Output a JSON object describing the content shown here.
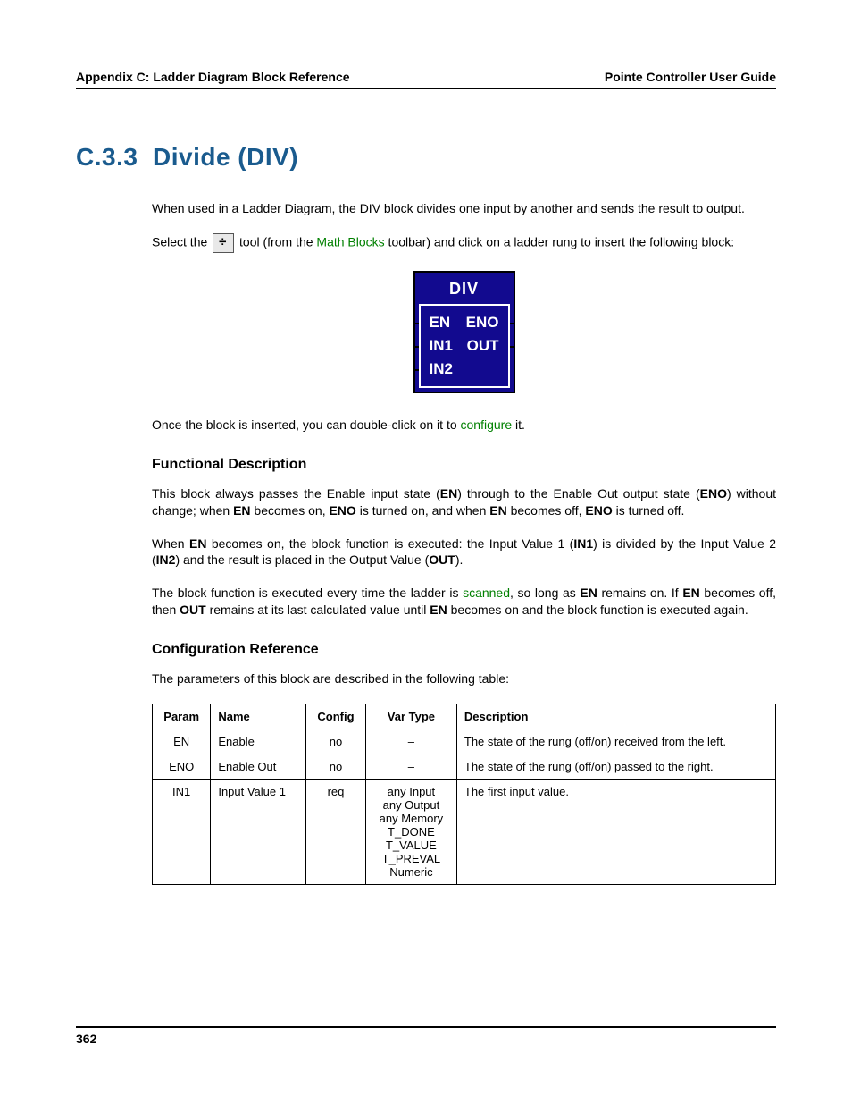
{
  "header": {
    "left": "Appendix C: Ladder Diagram Block Reference",
    "right": "Pointe Controller User Guide"
  },
  "section": {
    "number": "C.3.3",
    "title": "Divide (DIV)"
  },
  "intro": "When used in a Ladder Diagram, the DIV block divides one input by another and sends the result to output.",
  "select_pre": "Select the ",
  "select_mid": " tool (from the ",
  "select_link": "Math Blocks",
  "select_post": " toolbar) and click on a ladder rung to insert the following block:",
  "block": {
    "title": "DIV",
    "rows": {
      "r1l": "EN",
      "r1r": "ENO",
      "r2l": "IN1",
      "r2r": "OUT",
      "r3l": "IN2"
    }
  },
  "after_block_pre": "Once the block is inserted, you can double-click on it to ",
  "after_block_link": "configure",
  "after_block_post": " it.",
  "func_desc_heading": "Functional Description",
  "func": {
    "p1a": "This block always passes the Enable input state (",
    "p1b": ") through to the Enable Out output state (",
    "p1c": ") without change; when ",
    "p1d": " becomes on, ",
    "p1e": " is turned on, and when ",
    "p1f": " becomes off, ",
    "p1g": " is turned off.",
    "p2a": "When ",
    "p2b": " becomes on, the block function is executed: the Input Value 1 (",
    "p2c": ") is divided by the Input Value 2 (",
    "p2d": ") and the result is placed in the Output Value (",
    "p2e": ").",
    "p3a": "The block function is executed every time the ladder is ",
    "p3link": "scanned",
    "p3b": ", so long as ",
    "p3c": " remains on. If ",
    "p3d": " becomes off, then ",
    "p3e": " remains at its last calculated value until ",
    "p3f": " becomes on and the block function is executed again."
  },
  "bold": {
    "EN": "EN",
    "ENO": "ENO",
    "IN1": "IN1",
    "IN2": "IN2",
    "OUT": "OUT"
  },
  "config_heading": "Configuration Reference",
  "config_intro": "The parameters of this block are described in the following table:",
  "table": {
    "headers": {
      "p": "Param",
      "n": "Name",
      "c": "Config",
      "v": "Var Type",
      "d": "Description"
    },
    "rows": [
      {
        "param": "EN",
        "name": "Enable",
        "config": "no",
        "vartype": "–",
        "desc": "The state of the rung (off/on) received from the left."
      },
      {
        "param": "ENO",
        "name": "Enable Out",
        "config": "no",
        "vartype": "–",
        "desc": "The state of the rung (off/on) passed to the right."
      },
      {
        "param": "IN1",
        "name": "Input Value 1",
        "config": "req",
        "vartype": "any Input\nany Output\nany Memory\nT_DONE\nT_VALUE\nT_PREVAL\nNumeric",
        "desc": "The first input value."
      }
    ]
  },
  "footer": "362"
}
